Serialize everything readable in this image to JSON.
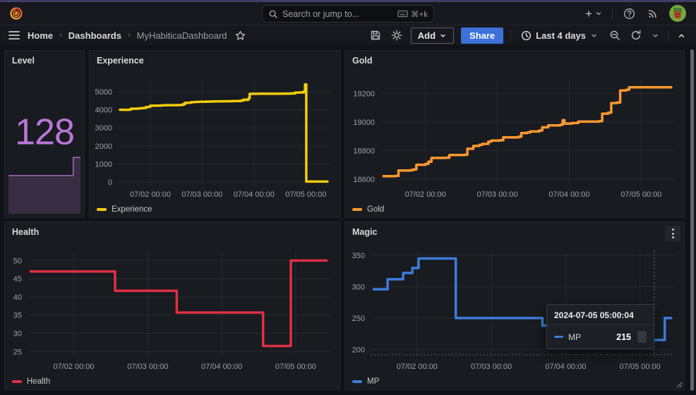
{
  "topbar": {
    "search_placeholder": "Search or jump to...",
    "shortcut": "⌘+k"
  },
  "breadcrumb": {
    "items": [
      "Home",
      "Dashboards",
      "MyHabiticaDashboard"
    ]
  },
  "toolbar": {
    "add_label": "Add",
    "share_label": "Share",
    "time_range": "Last 4 days"
  },
  "accent": {
    "share_button": "#3D71D9",
    "stat_purple": "#B877D9"
  },
  "tooltip": {
    "timestamp": "2024-07-05 05:00:04",
    "series": "MP",
    "value": "215"
  },
  "chart_data": [
    {
      "id": "level",
      "type": "area",
      "title": "Level",
      "value": "128",
      "color": "#B877D9",
      "legend_position": "none",
      "grid": false,
      "t_range": [
        -2,
        94
      ],
      "y_range": [
        124.9,
        133.6
      ],
      "points": [
        [
          -2,
          127
        ],
        [
          84,
          127
        ],
        [
          84.3,
          128
        ],
        [
          94,
          128
        ]
      ]
    },
    {
      "id": "experience",
      "type": "line",
      "title": "Experience",
      "legend": "Experience",
      "color": "#F2CC0C",
      "grid": true,
      "legend_position": "bottom-left",
      "t_range": [
        -3,
        95
      ],
      "y_range": [
        -150,
        5700
      ],
      "y_ticks": [
        0,
        1000,
        2000,
        3000,
        4000,
        5000
      ],
      "x_ticks": [
        {
          "t": 12,
          "label": "07/02 00:00"
        },
        {
          "t": 36,
          "label": "07/03 00:00"
        },
        {
          "t": 60,
          "label": "07/04 00:00"
        },
        {
          "t": 84,
          "label": "07/05 00:00"
        }
      ],
      "points": [
        [
          -2,
          4000
        ],
        [
          1,
          3995
        ],
        [
          2,
          4005
        ],
        [
          3,
          4060
        ],
        [
          6,
          4065
        ],
        [
          7,
          4085
        ],
        [
          9,
          4100
        ],
        [
          10,
          4150
        ],
        [
          11,
          4160
        ],
        [
          12,
          4220
        ],
        [
          14,
          4228
        ],
        [
          17,
          4240
        ],
        [
          19,
          4252
        ],
        [
          24,
          4258
        ],
        [
          26,
          4262
        ],
        [
          27,
          4300
        ],
        [
          28,
          4385
        ],
        [
          30,
          4395
        ],
        [
          31,
          4420
        ],
        [
          33,
          4435
        ],
        [
          35,
          4445
        ],
        [
          38,
          4452
        ],
        [
          41,
          4460
        ],
        [
          44,
          4468
        ],
        [
          47,
          4473
        ],
        [
          50,
          4478
        ],
        [
          53,
          4482
        ],
        [
          54,
          4508
        ],
        [
          55,
          4560
        ],
        [
          56,
          4545
        ],
        [
          57,
          4565
        ],
        [
          57.6,
          4650
        ],
        [
          58,
          4880
        ],
        [
          62,
          4885
        ],
        [
          74,
          4890
        ],
        [
          77,
          4900
        ],
        [
          79,
          4952
        ],
        [
          81,
          4960
        ],
        [
          83,
          5005
        ],
        [
          83.4,
          5020
        ],
        [
          83.6,
          5400
        ],
        [
          84,
          5400
        ],
        [
          84.2,
          30
        ],
        [
          94,
          30
        ]
      ]
    },
    {
      "id": "gold",
      "type": "line",
      "title": "Gold",
      "legend": "Gold",
      "color": "#FF9830",
      "grid": true,
      "legend_position": "bottom-left",
      "t_range": [
        -3,
        95
      ],
      "y_range": [
        18560,
        19300
      ],
      "y_ticks": [
        18600,
        18800,
        19000,
        19200
      ],
      "x_ticks": [
        {
          "t": 12,
          "label": "07/02 00:00"
        },
        {
          "t": 36,
          "label": "07/03 00:00"
        },
        {
          "t": 60,
          "label": "07/04 00:00"
        },
        {
          "t": 84,
          "label": "07/05 00:00"
        }
      ],
      "points": [
        [
          -2,
          18620
        ],
        [
          2,
          18622
        ],
        [
          3,
          18660
        ],
        [
          7,
          18662
        ],
        [
          8,
          18668
        ],
        [
          9,
          18700
        ],
        [
          12,
          18706
        ],
        [
          13,
          18722
        ],
        [
          14,
          18748
        ],
        [
          19,
          18750
        ],
        [
          20,
          18768
        ],
        [
          25,
          18770
        ],
        [
          26,
          18812
        ],
        [
          28,
          18832
        ],
        [
          30,
          18840
        ],
        [
          31,
          18846
        ],
        [
          33,
          18862
        ],
        [
          34,
          18870
        ],
        [
          37,
          18872
        ],
        [
          38,
          18892
        ],
        [
          43,
          18896
        ],
        [
          44,
          18922
        ],
        [
          46,
          18926
        ],
        [
          47,
          18933
        ],
        [
          50,
          18940
        ],
        [
          51,
          18962
        ],
        [
          53,
          18976
        ],
        [
          57,
          18980
        ],
        [
          57.8,
          19012
        ],
        [
          58.4,
          18988
        ],
        [
          61,
          18992
        ],
        [
          63,
          19002
        ],
        [
          70,
          19005
        ],
        [
          71,
          19058
        ],
        [
          73,
          19064
        ],
        [
          74,
          19132
        ],
        [
          76,
          19136
        ],
        [
          77,
          19220
        ],
        [
          79,
          19225
        ],
        [
          80,
          19242
        ],
        [
          94,
          19242
        ]
      ]
    },
    {
      "id": "health",
      "type": "line",
      "title": "Health",
      "legend": "Health",
      "color": "#E02F44",
      "grid": true,
      "legend_position": "bottom-left",
      "t_range": [
        -3,
        95
      ],
      "y_range": [
        23.5,
        52.8
      ],
      "y_ticks": [
        25,
        30,
        35,
        40,
        45,
        50
      ],
      "x_ticks": [
        {
          "t": 12,
          "label": "07/02 00:00"
        },
        {
          "t": 36,
          "label": "07/03 00:00"
        },
        {
          "t": 60,
          "label": "07/04 00:00"
        },
        {
          "t": 84,
          "label": "07/05 00:00"
        }
      ],
      "points": [
        [
          -2,
          47
        ],
        [
          25,
          47
        ],
        [
          25.4,
          41.7
        ],
        [
          45,
          41.7
        ],
        [
          45.4,
          35.7
        ],
        [
          73,
          35.7
        ],
        [
          73.4,
          26.5
        ],
        [
          82,
          26.5
        ],
        [
          82.4,
          50
        ],
        [
          94,
          50
        ]
      ]
    },
    {
      "id": "magic",
      "type": "line",
      "title": "Magic",
      "legend": "MP",
      "color": "#3D7DDB",
      "grid": true,
      "legend_position": "bottom-left",
      "t_range": [
        -3,
        95
      ],
      "y_range": [
        188,
        358
      ],
      "y_ticks": [
        200,
        250,
        300,
        350
      ],
      "x_ticks": [
        {
          "t": 12,
          "label": "07/02 00:00"
        },
        {
          "t": 36,
          "label": "07/03 00:00"
        },
        {
          "t": 60,
          "label": "07/04 00:00"
        },
        {
          "t": 84,
          "label": "07/05 00:00"
        }
      ],
      "crosshair": {
        "t": 88.6,
        "v": 191.5
      },
      "points": [
        [
          -2,
          296
        ],
        [
          2,
          296
        ],
        [
          2.5,
          312
        ],
        [
          7,
          312
        ],
        [
          7.5,
          322
        ],
        [
          10,
          322
        ],
        [
          10.5,
          330
        ],
        [
          12,
          330
        ],
        [
          12.5,
          345
        ],
        [
          24,
          345
        ],
        [
          24.5,
          250
        ],
        [
          52,
          250
        ],
        [
          52.5,
          238
        ],
        [
          60,
          238
        ],
        [
          60.5,
          215
        ],
        [
          91.5,
          215
        ],
        [
          92,
          250
        ],
        [
          94,
          250
        ]
      ]
    }
  ]
}
